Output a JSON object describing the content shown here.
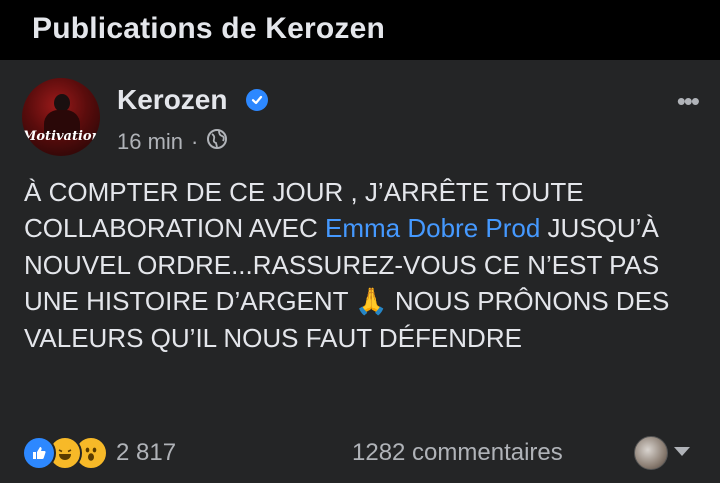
{
  "section": {
    "title": "Publications de Kerozen"
  },
  "post": {
    "author": "Kerozen",
    "avatar_top_text": "",
    "avatar_script": "Motivation",
    "time": "16 min",
    "separator": "·",
    "more_label": "•••",
    "text_part1": "À COMPTER DE CE JOUR , J’ARRÊTE TOUTE COLLABORATION AVEC ",
    "mention": "Emma Dobre Prod",
    "text_part2": " JUSQU’À NOUVEL ORDRE...RASSUREZ-VOUS CE N’EST PAS UNE HISTOIRE D’ARGENT ",
    "emoji": "🙏",
    "text_part3": " NOUS PRÔNONS DES VALEURS QU’IL NOUS FAUT DÉFENDRE"
  },
  "footer": {
    "reaction_count": "2 817",
    "comments": "1282 commentaires"
  },
  "icons": {
    "reactions": [
      "like-icon",
      "haha-icon",
      "wow-icon"
    ],
    "verified": "verified-badge-icon",
    "audience": "globe-icon"
  },
  "colors": {
    "background": "#000000",
    "card": "#242526",
    "text": "#e4e6eb",
    "muted": "#b0b3b8",
    "link": "#4599ff",
    "verified": "#2d88ff"
  }
}
